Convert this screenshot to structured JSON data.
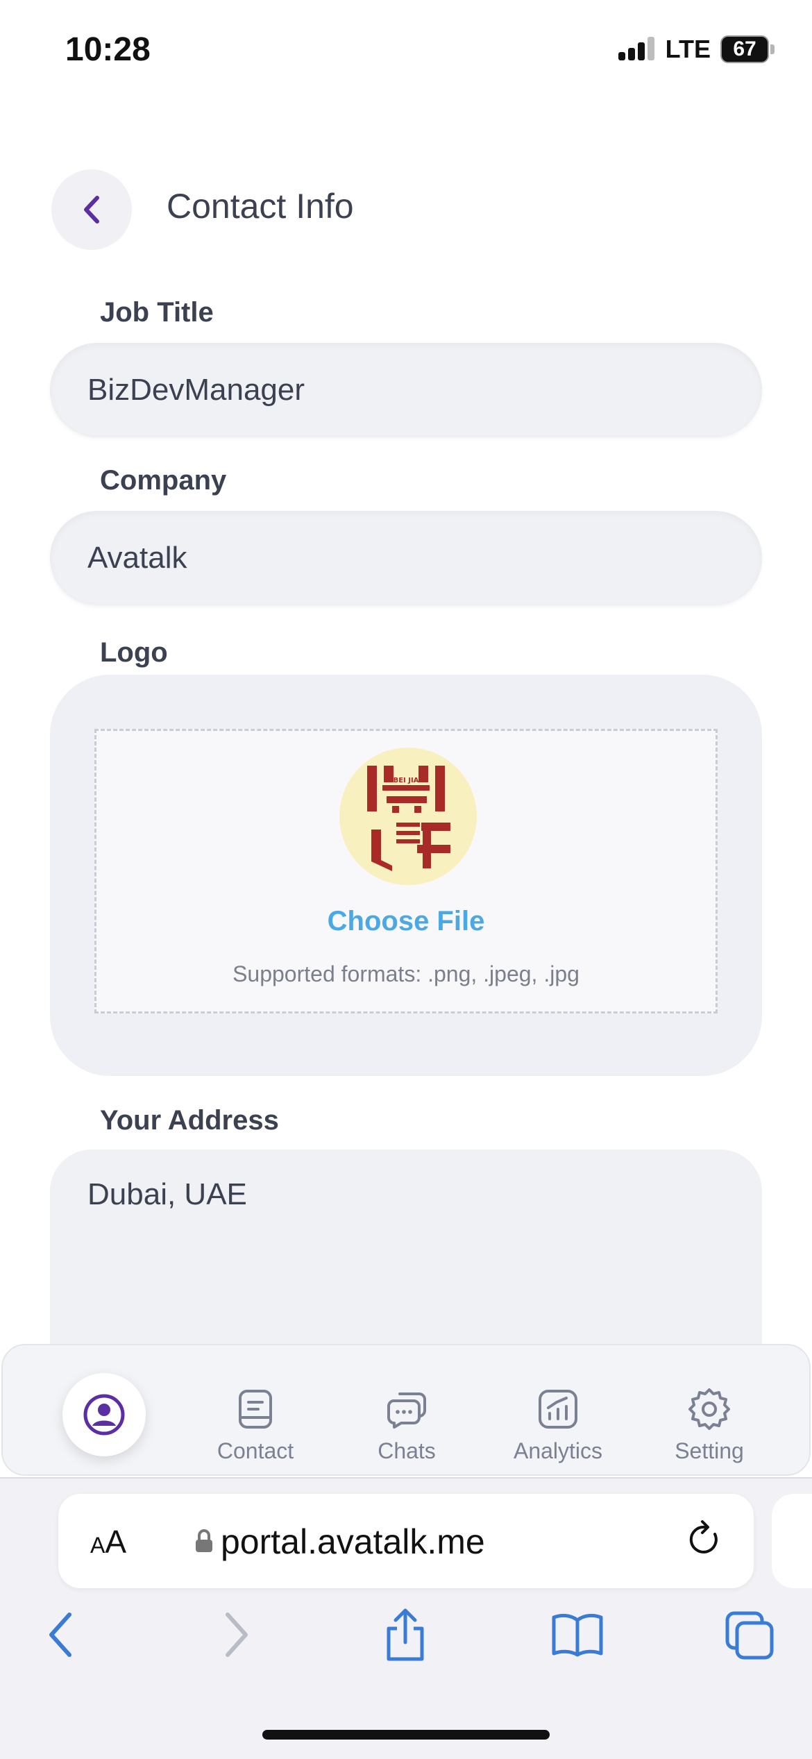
{
  "status_bar": {
    "time": "10:28",
    "network": "LTE",
    "battery": "67"
  },
  "header": {
    "title": "Contact Info"
  },
  "form": {
    "job_title": {
      "label": "Job Title",
      "value": "BizDevManager"
    },
    "company": {
      "label": "Company",
      "value": "Avatalk"
    },
    "logo": {
      "label": "Logo",
      "choose_file": "Choose File",
      "supported_formats": "Supported formats: .png, .jpeg, .jpg",
      "logo_text": "BEI JIA"
    },
    "address": {
      "label": "Your Address",
      "value": "Dubai, UAE"
    }
  },
  "bottom_nav": {
    "items": [
      {
        "label": "Contact",
        "icon": "contact-book-icon"
      },
      {
        "label": "Chats",
        "icon": "chat-bubbles-icon"
      },
      {
        "label": "Analytics",
        "icon": "analytics-chart-icon"
      },
      {
        "label": "Setting",
        "icon": "gear-icon"
      }
    ],
    "active_icon": "profile-icon"
  },
  "browser": {
    "aa_small": "A",
    "aa_large": "A",
    "url": "portal.avatalk.me"
  },
  "colors": {
    "accent": "#5b2fa3",
    "link": "#4aa8e4",
    "safari_blue": "#3a7bd5",
    "logo_red": "#a82b28",
    "logo_bg": "#f8f1bf"
  }
}
